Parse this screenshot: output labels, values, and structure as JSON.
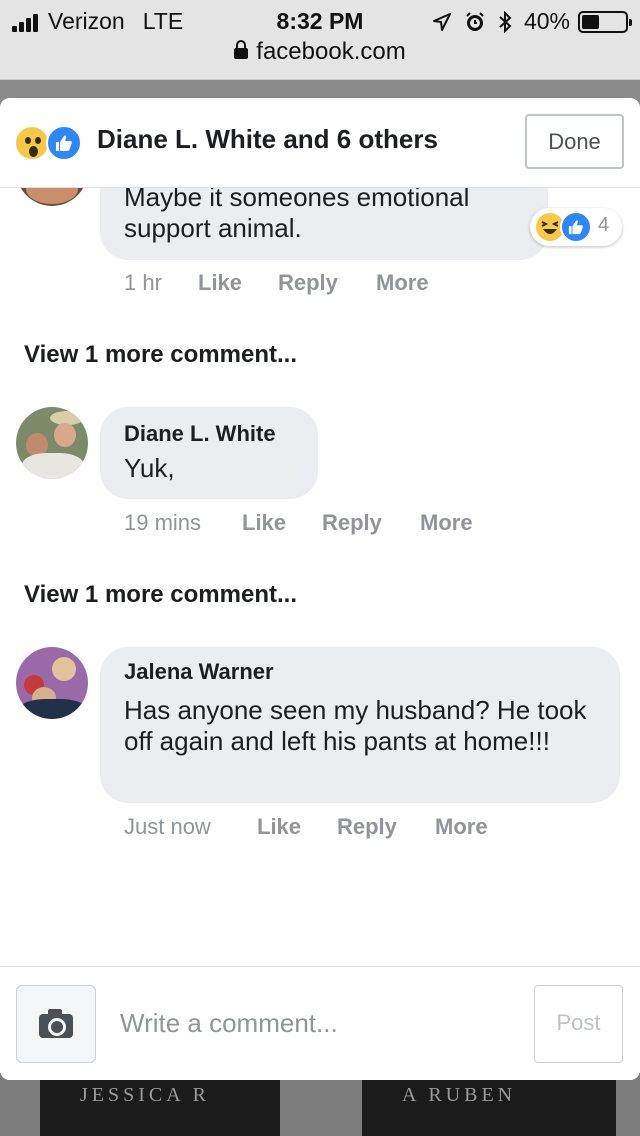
{
  "status_bar": {
    "carrier": "Verizon",
    "network": "LTE",
    "time": "8:32 PM",
    "battery": "40%",
    "battery_level": 0.4,
    "icons": [
      "signal-icon",
      "location-arrow-icon",
      "alarm-icon",
      "bluetooth-icon",
      "battery-icon"
    ]
  },
  "browser": {
    "url": "facebook.com",
    "icons": [
      "lock-icon"
    ]
  },
  "background": {
    "book_left_text": "JESSICA R",
    "book_right_text": "A RUBEN"
  },
  "header": {
    "reactions": [
      "wow-reaction-icon",
      "like-reaction-icon"
    ],
    "title": "Diane L. White and 6 others",
    "done_label": "Done"
  },
  "comments": [
    {
      "text": "Maybe it someones emotional support animal.",
      "reactions": {
        "icons": [
          "haha-reaction-icon",
          "like-reaction-icon"
        ],
        "count": "4"
      },
      "time": "1 hr",
      "like": "Like",
      "reply": "Reply",
      "more": "More"
    },
    {
      "author": "Diane L. White",
      "text": "Yuk,",
      "time": "19 mins",
      "like": "Like",
      "reply": "Reply",
      "more": "More"
    },
    {
      "author": "Jalena Warner",
      "text": "Has anyone seen my husband? He took off again and left his pants at home!!!",
      "time": "Just now",
      "like": "Like",
      "reply": "Reply",
      "more": "More"
    }
  ],
  "view_more_links": [
    "View 1 more comment...",
    "View 1 more comment..."
  ],
  "composer": {
    "placeholder": "Write a comment...",
    "post_label": "Post",
    "icons": [
      "camera-icon"
    ]
  },
  "colors": {
    "link_blue": "#2f86f6",
    "bubble_gray": "#ebedf0",
    "meta_gray": "#90949c",
    "text_dark": "#1c1e21"
  }
}
